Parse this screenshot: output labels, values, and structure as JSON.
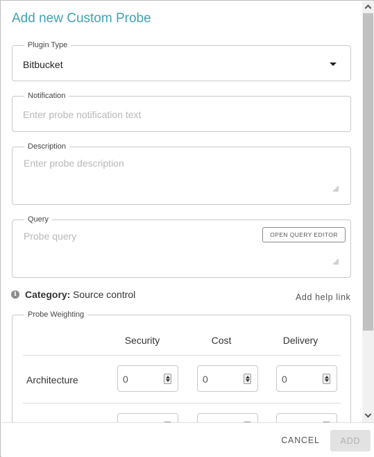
{
  "dialog": {
    "title": "Add new Custom Probe"
  },
  "plugin_type": {
    "label": "Plugin Type",
    "value": "Bitbucket"
  },
  "notification": {
    "label": "Notification",
    "placeholder": "Enter probe notification text"
  },
  "description": {
    "label": "Description",
    "placeholder": "Enter probe description"
  },
  "query": {
    "label": "Query",
    "placeholder": "Probe query",
    "editor_button": "OPEN QUERY EDITOR"
  },
  "category": {
    "label": "Category:",
    "value": "Source control",
    "help_link": "Add help link"
  },
  "weighting": {
    "label": "Probe Weighting",
    "columns": [
      "Security",
      "Cost",
      "Delivery"
    ],
    "rows": [
      {
        "label": "Architecture",
        "values": [
          "0",
          "0",
          "0"
        ]
      },
      {
        "label": "",
        "values": [
          "",
          "",
          ""
        ]
      }
    ]
  },
  "footer": {
    "cancel": "CANCEL",
    "add": "ADD"
  },
  "icons": {
    "info": "info-icon",
    "dropdown": "caret-down-icon",
    "spinner": "spinner-arrows-icon",
    "resize": "resize-grip-icon"
  },
  "colors": {
    "title": "#3ea3b1",
    "border": "#c8c8c8",
    "disabled_button": "#e2e2e2"
  }
}
